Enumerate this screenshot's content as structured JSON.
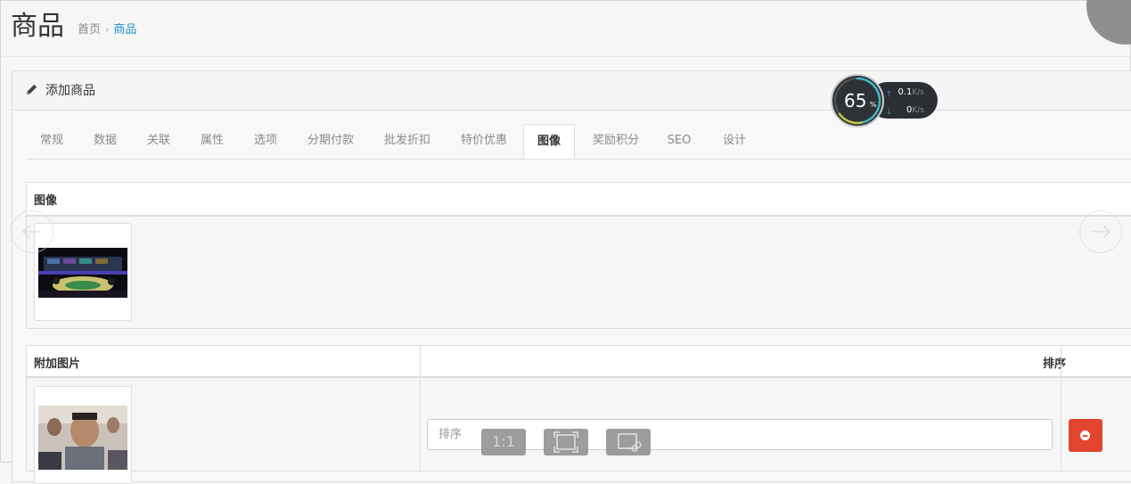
{
  "header": {
    "title": "商品",
    "breadcrumb": {
      "home": "首页",
      "separator": "›",
      "current": "商品"
    }
  },
  "panel": {
    "title": "添加商品",
    "icon": "pencil-icon"
  },
  "tabs": [
    {
      "label": "常规"
    },
    {
      "label": "数据"
    },
    {
      "label": "关联"
    },
    {
      "label": "属性"
    },
    {
      "label": "选项"
    },
    {
      "label": "分期付款"
    },
    {
      "label": "批发折扣"
    },
    {
      "label": "特价优惠"
    },
    {
      "label": "图像",
      "active": true
    },
    {
      "label": "奖励积分"
    },
    {
      "label": "SEO"
    },
    {
      "label": "设计"
    }
  ],
  "image_section": {
    "heading": "图像"
  },
  "additional_images": {
    "heading": "附加图片",
    "sort_heading": "排序",
    "rows": [
      {
        "sort_placeholder": "排序",
        "sort_value": ""
      }
    ]
  },
  "speed_widget": {
    "percent": "65",
    "percent_sign": "%",
    "upload": "0.1",
    "download": "0",
    "unit": "K/s"
  },
  "viewer_toolbar": {
    "actual_size_label": "1:1"
  },
  "colors": {
    "accent": "#1e91cf",
    "danger": "#e2452f",
    "active_tab_text": "#333333",
    "tab_text": "#8a8a8a"
  }
}
